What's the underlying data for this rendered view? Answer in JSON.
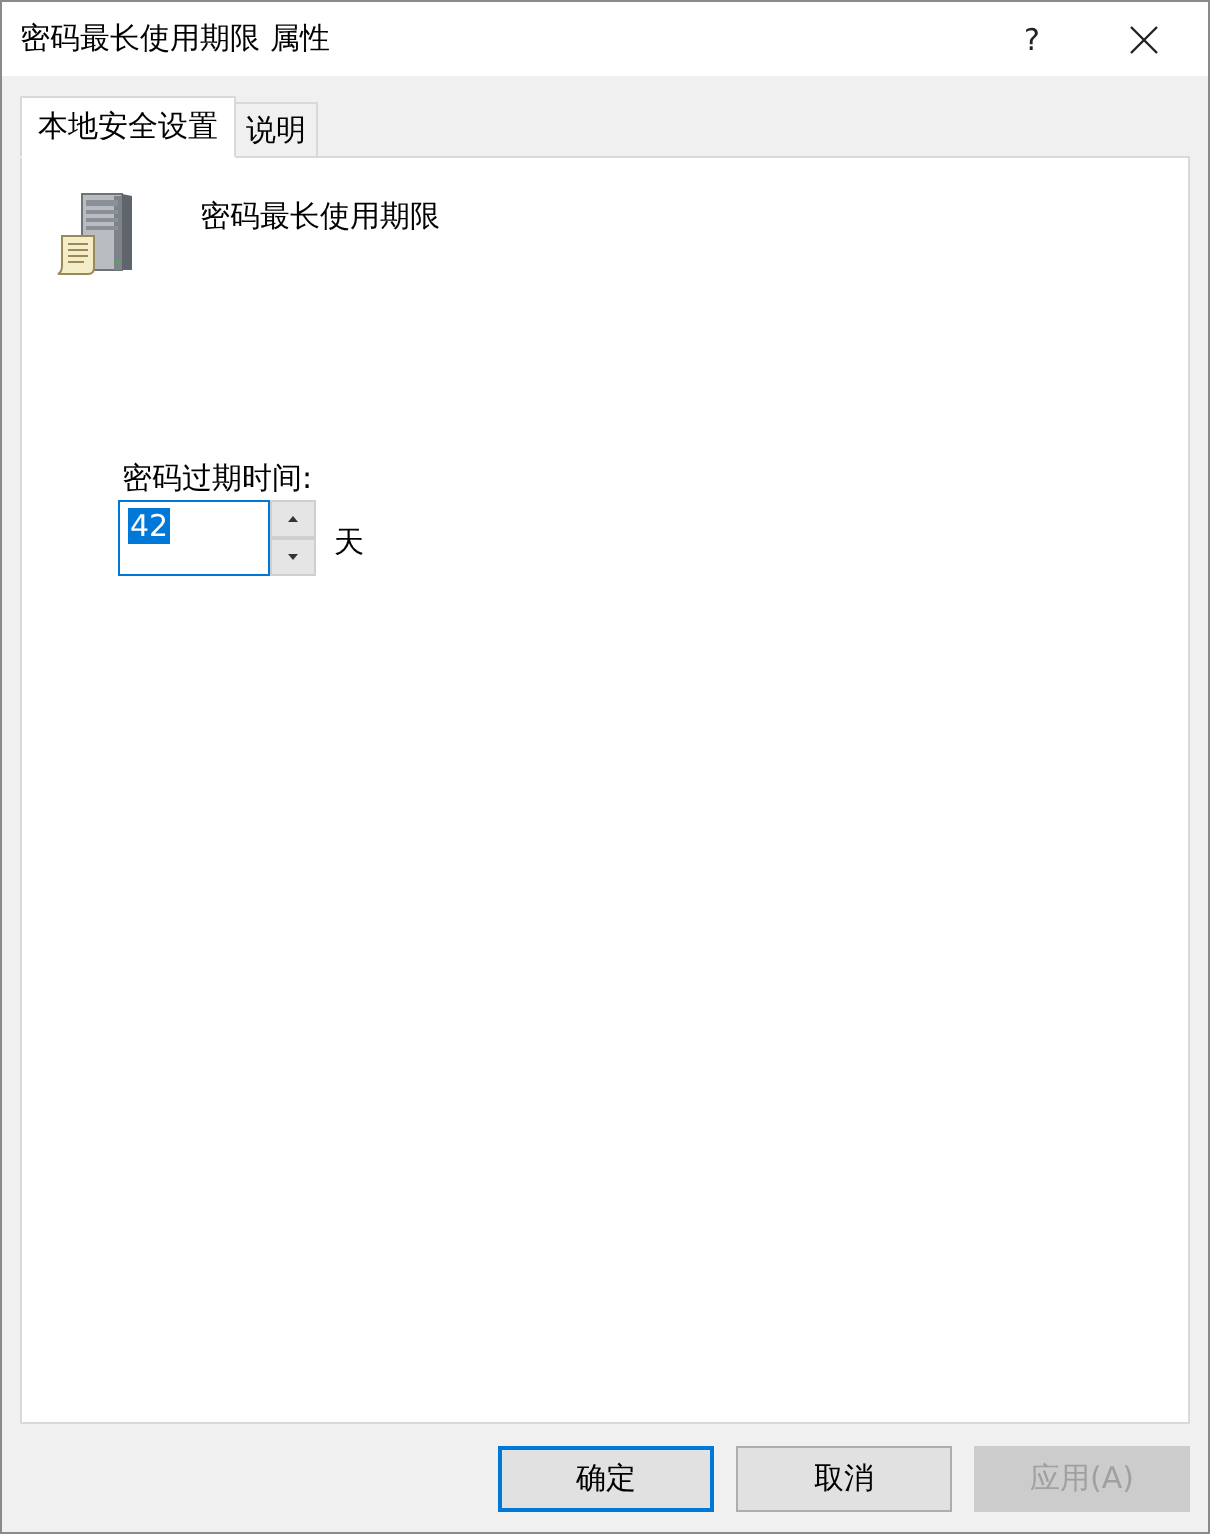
{
  "window": {
    "title": "密码最长使用期限 属性",
    "help": "?"
  },
  "tabs": [
    {
      "label": "本地安全设置",
      "selected": true
    },
    {
      "label": "说明",
      "selected": false
    }
  ],
  "policy": {
    "name": "密码最长使用期限"
  },
  "expiry": {
    "label": "密码过期时间:",
    "value": "42",
    "focused": true,
    "unit": "天"
  },
  "buttons": [
    {
      "label": "确定",
      "default": true,
      "disabled": false
    },
    {
      "label": "取消",
      "default": false,
      "disabled": false
    },
    {
      "label": "应用(A)",
      "default": false,
      "disabled": true
    }
  ]
}
